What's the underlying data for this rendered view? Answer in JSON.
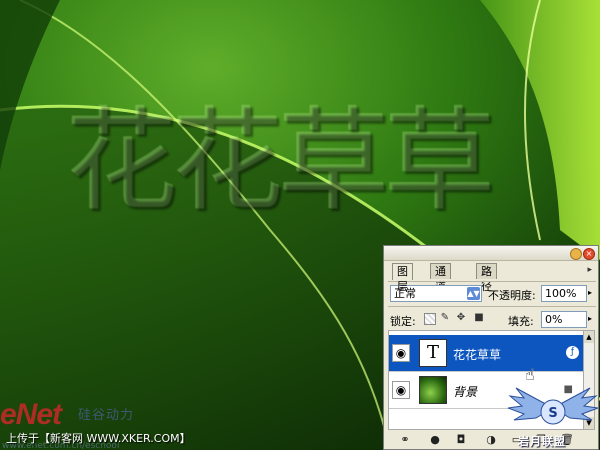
{
  "canvas": {
    "headline": "花花草草"
  },
  "watermarks": {
    "enet_logo": "eNet",
    "enet_subtitle": "硅谷动力",
    "enet_url": "www.enet.com.cn/eschool",
    "uploader": "上传于【新客网 WWW.XKER.COM】",
    "corner_logo_text": "岩月联盟",
    "corner_logo_url": "www.5yue.com"
  },
  "layers_panel": {
    "tabs": [
      {
        "label": "图层",
        "active": true
      },
      {
        "label": "通道",
        "active": false
      },
      {
        "label": "路径",
        "active": false
      }
    ],
    "blend_mode": "正常",
    "opacity_label": "不透明度:",
    "opacity_value": "100%",
    "lock_label": "锁定:",
    "fill_label": "填充:",
    "fill_value": "0%",
    "layers": [
      {
        "name": "花花草草",
        "type": "text",
        "thumb": "T",
        "selected": true,
        "visible": true
      },
      {
        "name": "背景",
        "type": "image",
        "selected": false,
        "visible": true
      }
    ],
    "icons": [
      "eye-icon",
      "text-layer-icon",
      "layer-fx-icon",
      "lock-icon",
      "link-icon",
      "add-style-icon",
      "mask-icon",
      "adjustment-icon",
      "folder-icon",
      "new-layer-icon",
      "trash-icon",
      "hand-cursor-icon"
    ]
  },
  "colors": {
    "selected_layer": "#0d55bf",
    "panel_bg": "#ece9d8",
    "leaf_green": "#4c9a1c"
  }
}
